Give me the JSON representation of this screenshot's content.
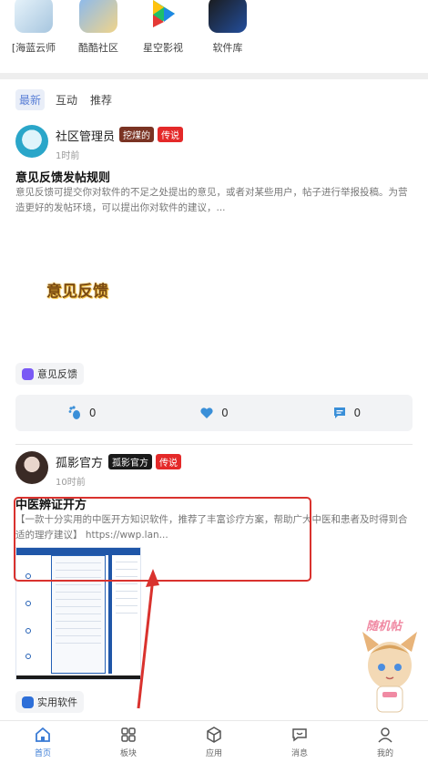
{
  "apps": [
    {
      "label": "[海蓝云师",
      "icon": "app-haiyun-icon"
    },
    {
      "label": "酷酷社区",
      "icon": "app-kuku-icon"
    },
    {
      "label": "星空影视",
      "icon": "app-xingkong-icon"
    },
    {
      "label": "软件库",
      "icon": "app-ruanjianku-icon"
    }
  ],
  "tabs": [
    {
      "label": "最新",
      "active": true
    },
    {
      "label": "互动",
      "active": false
    },
    {
      "label": "推荐",
      "active": false
    }
  ],
  "post1": {
    "author": "社区管理员",
    "badge1": "挖煤的",
    "badge2": "传说",
    "time": "1时前",
    "title": "意见反馈发帖规则",
    "body": "意见反馈可提交你对软件的不足之处提出的意见，或者对某些用户，帖子进行举报投稿。为营造更好的发帖环境，可以提出你对软件的建议，...",
    "logo_text": "意见反馈",
    "tag": "意见反馈",
    "actions": {
      "likes": "0",
      "hearts": "0",
      "comments": "0"
    }
  },
  "post2": {
    "author": "孤影官方",
    "badge1": "孤影官方",
    "badge2": "传说",
    "time": "10时前",
    "title": "中医辨证开方",
    "body": "【一款十分实用的中医开方知识软件，推荐了丰富诊疗方案，帮助广大中医和患者及时得到合适的理疗建议】 https://wwp.lan...",
    "tag": "实用软件"
  },
  "mascot_text": "随机帖",
  "nav": [
    {
      "label": "首页",
      "icon": "home-icon",
      "active": true
    },
    {
      "label": "板块",
      "icon": "grid-icon",
      "active": false
    },
    {
      "label": "应用",
      "icon": "cube-icon",
      "active": false
    },
    {
      "label": "消息",
      "icon": "message-icon",
      "active": false
    },
    {
      "label": "我的",
      "icon": "user-icon",
      "active": false
    }
  ],
  "colors": {
    "accent": "#3a7bd5",
    "highlight": "#d9322e",
    "badge_red": "#e42929",
    "badge_brown": "#7a3323"
  }
}
